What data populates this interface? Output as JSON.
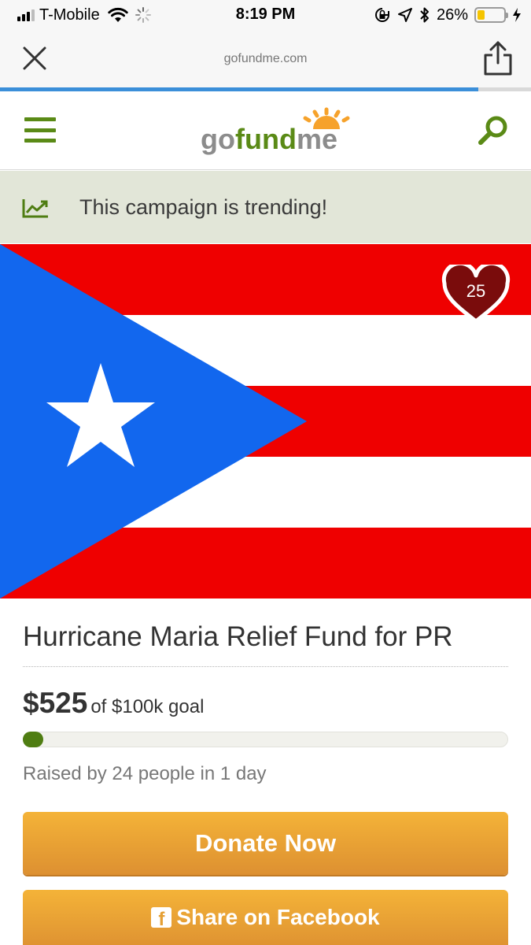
{
  "status_bar": {
    "carrier": "T-Mobile",
    "time": "8:19 PM",
    "battery_percent": "26%",
    "battery_level": 0.26,
    "icons": [
      "signal-icon",
      "wifi-icon",
      "activity-spinner-icon",
      "orientation-lock-icon",
      "location-arrow-icon",
      "bluetooth-icon",
      "battery-icon",
      "charging-bolt-icon"
    ]
  },
  "browser": {
    "url": "gofundme.com",
    "load_progress": 0.9,
    "icons": [
      "close-icon",
      "share-icon"
    ]
  },
  "header": {
    "logo": {
      "go": "go",
      "fund": "fund",
      "me": "me"
    },
    "icons": [
      "menu-icon",
      "search-icon"
    ],
    "brand_color": "#5a8a16"
  },
  "trending": {
    "text": "This campaign is trending!",
    "icon": "trending-chart-icon"
  },
  "campaign": {
    "image": "puerto-rico-flag",
    "hearts": "25",
    "title": "Hurricane Maria Relief Fund for PR",
    "raised": "$525",
    "goal_text": "of $100k goal",
    "progress": 0.00525,
    "supporters_text": "Raised by 24 people in 1 day",
    "donate_label": "Donate Now",
    "share_label": "Share on Facebook",
    "button_color": "#f0a93a"
  }
}
